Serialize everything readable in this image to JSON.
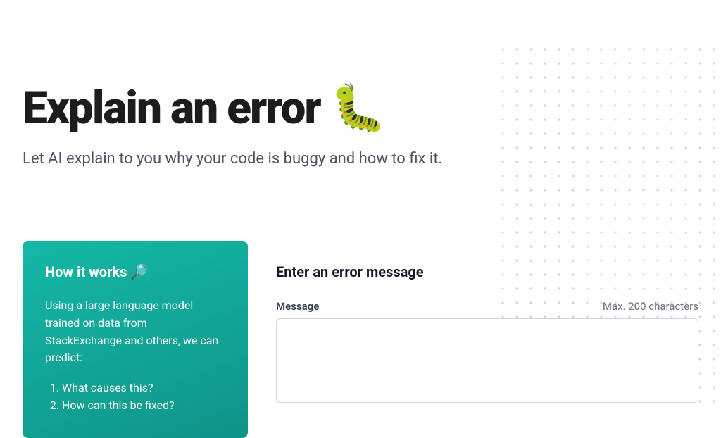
{
  "hero": {
    "title": "Explain an error 🐛",
    "subtitle": "Let AI explain to you why your code is buggy and how to fix it."
  },
  "card": {
    "title": "How it works 🔎",
    "body": "Using a large language model trained on data from StackExchange and others, we can predict:",
    "items": [
      "What causes this?",
      "How can this be fixed?"
    ]
  },
  "form": {
    "title": "Enter an error message",
    "label": "Message",
    "hint": "Max. 200 characters",
    "value": ""
  }
}
